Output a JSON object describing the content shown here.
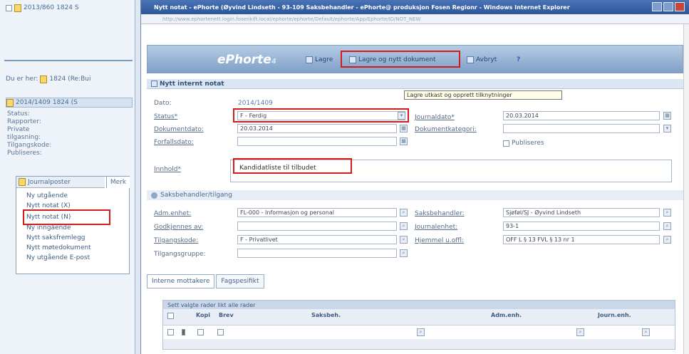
{
  "left_pane": {
    "top_row": {
      "id": "2013/860",
      "code": "1824 S"
    },
    "breadcrumb": {
      "prefix": "Du er her:",
      "code": "1824 (Re:Bui"
    },
    "case_row": {
      "id": "2014/1409",
      "code": "1824 (S"
    },
    "meta_labels": [
      "Status:",
      "Rapporter:",
      "Private tilgasning:",
      "Tilgangskode:",
      "Publiseres:"
    ],
    "menu": {
      "header": "Journalposter",
      "tab": "Merk",
      "items": [
        "Ny utgående",
        "Nytt notat (X)",
        "Nytt notat (N)",
        "Ny inngående",
        "Nytt saksfremlegg",
        "Nytt møtedokument",
        "Ny utgående E-post"
      ]
    }
  },
  "window": {
    "title": "Nytt notat - ePhorte (Øyvind Lindseth - 93-109 Saksbehandler - ePhorte@ produksjon Fosen Regionr - Windows Internet Explorer",
    "address": "http://www.ephortenett.login.fosenkift.local/ephorte/ephorte/Default/ephorte/App/Ephorte/ID/NOT_NEW"
  },
  "toolbar": {
    "logo": "ePhorte",
    "logo_version": "4",
    "save": "Lagre",
    "save_new": "Lagre og nytt dokument",
    "cancel": "Avbryt",
    "help_icon": "?"
  },
  "tooltip": "Lagre utkast og opprett tilknytninger",
  "panel_title": "Nytt internt notat",
  "form": {
    "dato_label": "Dato:",
    "dato_value": "2014/1409",
    "status_label": "Status*",
    "status_value": "F - Ferdig",
    "journaldato_label": "Journaldato*",
    "journaldato_value": "20.03.2014",
    "dokumentdato_label": "Dokumentdato:",
    "dokumentdato_value": "20.03.2014",
    "dokumentkategori_label": "Dokumentkategori:",
    "dokumentkategori_value": "",
    "forfall_label": "Forfallsdato:",
    "forfall_value": "",
    "publiseres_label": "Publiseres",
    "innhold_label": "Innhold*",
    "innhold_value": "Kandidatliste til tilbudet"
  },
  "section2": {
    "title": "Saksbehandler/tilgang",
    "adm_label": "Adm.enhet:",
    "adm_value": "FL-000 - Informasjon og personal",
    "saksbeh_label": "Saksbehandler:",
    "saksbeh_value": "Sjøføl/SJ - Øyvind Lindseth",
    "godkjent_label": "Godkjennes av:",
    "godkjent_value": "",
    "journalenhet_label": "Journalenhet:",
    "journalenhet_value": "93-1",
    "tilgang_label": "Tilgangskode:",
    "tilgang_value": "F - Privatlivet",
    "hjemmel_label": "Hjemmel u.offl:",
    "hjemmel_value": "OFF L § 13 FVL § 13 nr 1",
    "tilgangsgruppe_label": "Tilgangsgruppe:",
    "tilgangsgruppe_value": ""
  },
  "tabs": [
    "Interne mottakere",
    "Fagspesifikt"
  ],
  "grid": {
    "toolbar_text": "Sett valgte rader likt alle rader",
    "headers": [
      "Kopi",
      "Brev",
      "Saksbeh.",
      "Adm.enh.",
      "Journ.enh."
    ]
  }
}
